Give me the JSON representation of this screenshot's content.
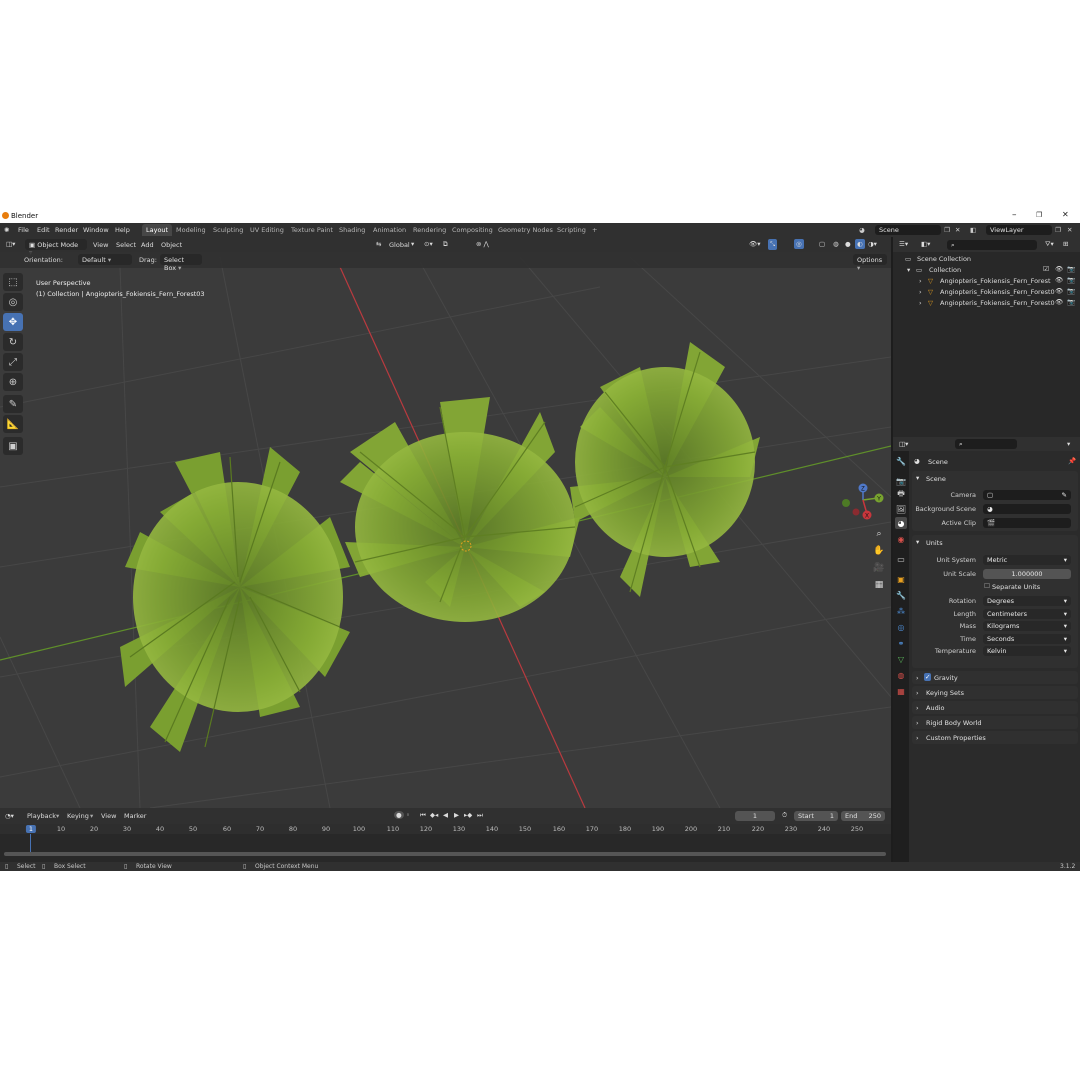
{
  "titlebar": {
    "title": "Blender",
    "minimize": "–",
    "maximize": "❐",
    "close": "✕"
  },
  "menu": {
    "items": [
      "File",
      "Edit",
      "Render",
      "Window",
      "Help"
    ]
  },
  "workspaces": [
    "Layout",
    "Modeling",
    "Sculpting",
    "UV Editing",
    "Texture Paint",
    "Shading",
    "Animation",
    "Rendering",
    "Compositing",
    "Geometry Nodes",
    "Scripting"
  ],
  "workspace_add": "+",
  "scene_field": "Scene",
  "viewlayer_field": "ViewLayer",
  "viewport_header": {
    "mode": "Object Mode",
    "menus": [
      "View",
      "Select",
      "Add",
      "Object"
    ],
    "transform_orientation": "Global"
  },
  "tool_settings": {
    "orientation_label": "Orientation:",
    "orientation_value": "Default",
    "drag_label": "Drag:",
    "drag_value": "Select Box",
    "options": "Options"
  },
  "viewport_overlay": {
    "perspective": "User Perspective",
    "collection": "(1) Collection | Angiopteris_Fokiensis_Fern_Forest03"
  },
  "gizmo": {
    "z": "Z",
    "y": "Y",
    "x": "X"
  },
  "outliner": {
    "scene_collection": "Scene Collection",
    "collection": "Collection",
    "objects": [
      "Angiopteris_Fokiensis_Fern_Forest",
      "Angiopteris_Fokiensis_Fern_Forest0",
      "Angiopteris_Fokiensis_Fern_Forest0"
    ]
  },
  "properties": {
    "context": "Scene",
    "scene_panel": {
      "title": "Scene",
      "camera_label": "Camera",
      "background_label": "Background Scene",
      "clip_label": "Active Clip"
    },
    "units_panel": {
      "title": "Units",
      "unit_system_label": "Unit System",
      "unit_system": "Metric",
      "unit_scale_label": "Unit Scale",
      "unit_scale": "1.000000",
      "separate_units": "Separate Units",
      "rotation_label": "Rotation",
      "rotation": "Degrees",
      "length_label": "Length",
      "length": "Centimeters",
      "mass_label": "Mass",
      "mass": "Kilograms",
      "time_label": "Time",
      "time": "Seconds",
      "temperature_label": "Temperature",
      "temperature": "Kelvin"
    },
    "collapsed_panels": [
      "Gravity",
      "Keying Sets",
      "Audio",
      "Rigid Body World",
      "Custom Properties"
    ]
  },
  "timeline": {
    "menus": [
      "Playback",
      "Keying",
      "View",
      "Marker"
    ],
    "current_frame": "1",
    "start_label": "Start",
    "start": "1",
    "end_label": "End",
    "end": "250",
    "ticks": [
      "1",
      "10",
      "20",
      "30",
      "40",
      "50",
      "60",
      "70",
      "80",
      "90",
      "100",
      "110",
      "120",
      "130",
      "140",
      "150",
      "160",
      "170",
      "180",
      "190",
      "200",
      "210",
      "220",
      "230",
      "240",
      "250"
    ]
  },
  "statusbar": {
    "select": "Select",
    "box_select": "Box Select",
    "rotate_view": "Rotate View",
    "context_menu": "Object Context Menu",
    "version": "3.1.2"
  },
  "colors": {
    "accent": "#4772b3",
    "fern_green": "#7aa02e",
    "x_axis": "#c8363c",
    "y_axis": "#6c9a2a"
  }
}
